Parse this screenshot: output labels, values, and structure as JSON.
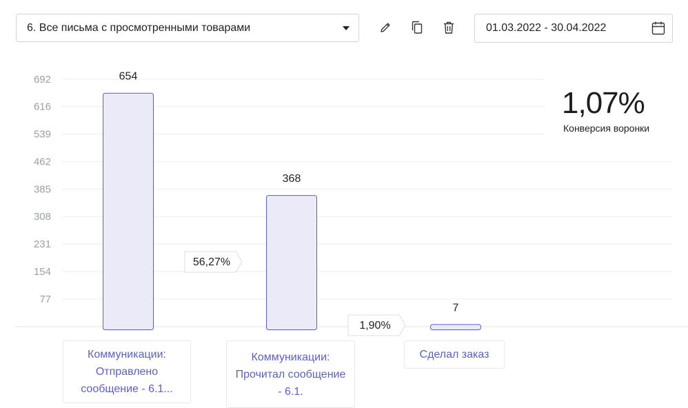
{
  "toolbar": {
    "funnel_select": "6. Все письма с просмотренными товарами",
    "date_range": "01.03.2022 - 30.04.2022",
    "icons": [
      "pencil-icon",
      "copy-icon",
      "trash-icon",
      "calendar-icon"
    ]
  },
  "kpi": {
    "value": "1,07%",
    "label": "Конверсия воронки"
  },
  "chart_data": {
    "type": "bar",
    "categories": [
      "Коммуникации: Отправлено сообщение - 6.1...",
      "Коммуникации: Прочитал сообщение - 6.1.",
      "Сделал заказ"
    ],
    "values": [
      654,
      368,
      7
    ],
    "value_labels": [
      "654",
      "368",
      "7"
    ],
    "step_conversions": [
      "56,27%",
      "1,90%"
    ],
    "yticks": [
      77,
      154,
      231,
      308,
      385,
      462,
      539,
      616,
      692
    ],
    "ylim": [
      0,
      692
    ],
    "grid": true,
    "colors": {
      "bar_fill": "#ebeaf8",
      "bar_stroke": "#5b5fc7",
      "grid": "#ececec",
      "tick_text": "#9aa0a8",
      "label_text": "#5b5fc7"
    }
  }
}
